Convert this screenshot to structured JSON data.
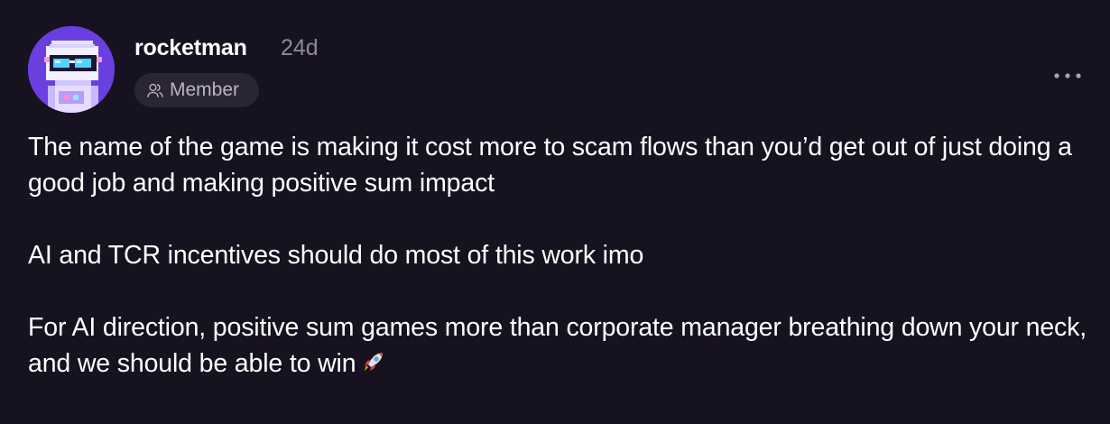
{
  "post": {
    "author": {
      "username": "rocketman",
      "time_ago": "24d",
      "role_badge": "Member",
      "avatar_icon": "pixel-astronaut-avatar"
    },
    "menu_icon": "more-horizontal-icon",
    "paragraphs": [
      "The name of the game is making it cost more to scam flows than you’d get out of just doing a good job and making positive sum impact",
      "AI and TCR incentives should do most of this work imo",
      "For AI direction, positive sum games more than corporate manager breathing down your neck, and we should be able to win"
    ],
    "trailing_emoji_icon": "rocket-icon"
  },
  "colors": {
    "background": "#17121f",
    "text": "#ffffff",
    "muted": "#8d8898",
    "badge_bg": "#2a2533",
    "avatar_bg": "#6a3fe0"
  }
}
